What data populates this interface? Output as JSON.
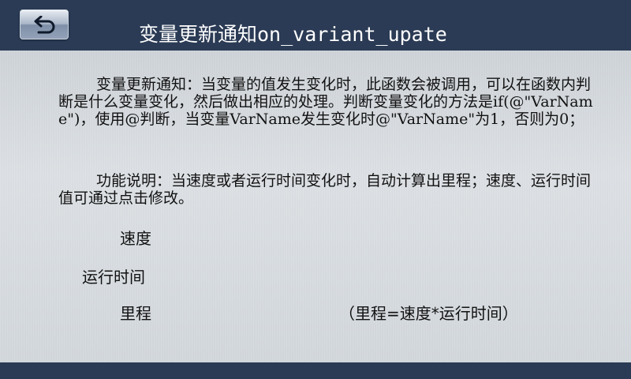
{
  "header": {
    "title": "变量更新通知on_variant_upate",
    "back_icon": "return-arrow-icon"
  },
  "main": {
    "description_1": "变量更新通知：当变量的值发生变化时，此函数会被调用，可以在函数内判断是什么变量变化，然后做出相应的处理。判断变量变化的方法是if(@\"VarName\")，使用@判断，当变量VarName发生变化时@\"VarName\"为1，否则为0；",
    "description_2": "功能说明：当速度或者运行时间变化时，自动计算出里程；速度、运行时间值可通过点击修改。",
    "fields": [
      {
        "label": "速度",
        "value": ""
      },
      {
        "label": "运行时间",
        "value": ""
      },
      {
        "label": "里程",
        "value": ""
      }
    ],
    "formula_note": "（里程=速度*运行时间）"
  },
  "colors": {
    "bar": "#2b3b55",
    "panel": "#d8dcdf",
    "title_text": "#ffffff",
    "body_text": "#111111"
  }
}
